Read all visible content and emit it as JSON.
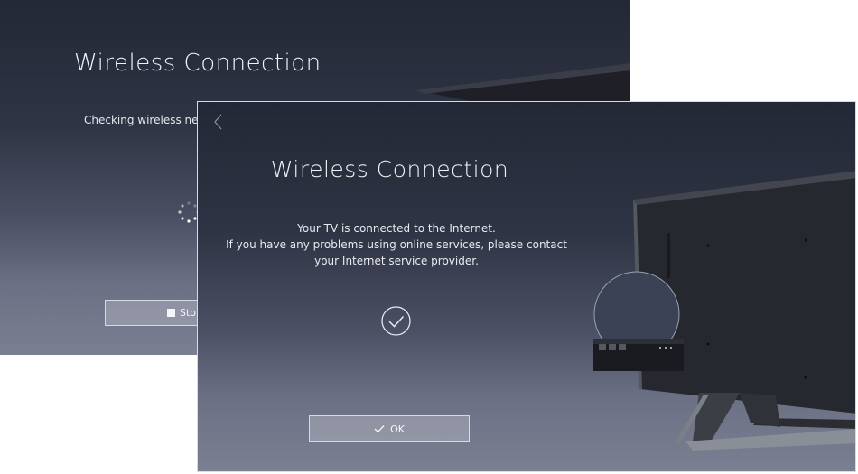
{
  "back_screen": {
    "title": "Wireless Connection",
    "status_text": "Checking wireless netw",
    "stop_button_label": "Stop"
  },
  "front_screen": {
    "title": "Wireless Connection",
    "message_lines": [
      "Your TV is connected to the Internet.",
      "If you have any problems using online services, please contact",
      "your Internet service provider."
    ],
    "ok_button_label": "OK"
  },
  "icons": {
    "spinner": "loading-spinner-icon",
    "check": "check-circle-icon",
    "ok_check": "checkmark-icon",
    "stop": "stop-square-icon",
    "back": "chevron-left-icon"
  },
  "colors": {
    "background_top": "#232836",
    "background_bottom": "#7b7f92",
    "text": "#f2f3f6",
    "button_border": "#d8dae2"
  }
}
